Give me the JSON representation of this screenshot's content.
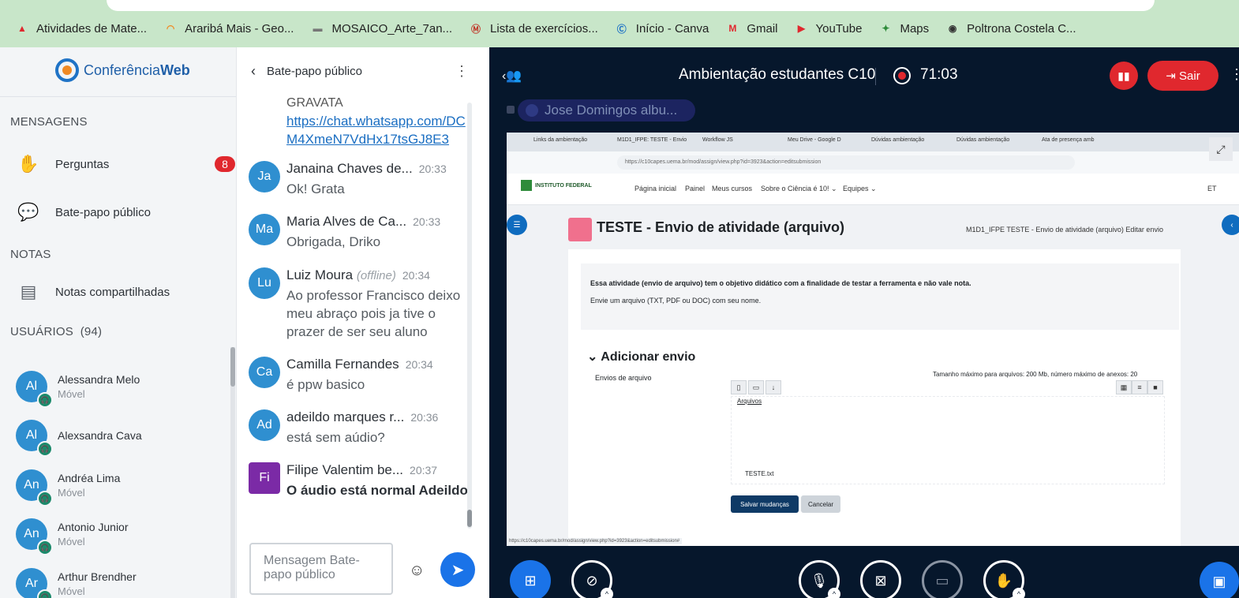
{
  "bookmarks": [
    {
      "label": "Atividades de Mate...",
      "icon": "red-triangle-icon",
      "color": "#e0282e"
    },
    {
      "label": "Araribá Mais - Geo...",
      "icon": "rainbow-icon",
      "color": "#f08a24"
    },
    {
      "label": "MOSAICO_Arte_7an...",
      "icon": "dash-icon",
      "color": "#777777"
    },
    {
      "label": "Lista de exercícios...",
      "icon": "circle-m-icon",
      "color": "#c0392b"
    },
    {
      "label": "Início - Canva",
      "icon": "canva-icon",
      "color": "#1f73c6"
    },
    {
      "label": "Gmail",
      "icon": "gmail-icon",
      "color": "#e0282e"
    },
    {
      "label": "YouTube",
      "icon": "youtube-icon",
      "color": "#e0282e"
    },
    {
      "label": "Maps",
      "icon": "maps-icon",
      "color": "#2e8b3a"
    },
    {
      "label": "Poltrona Costela C...",
      "icon": "globe-icon",
      "color": "#333333"
    }
  ],
  "logo": {
    "part1": "Conferência",
    "part2": "Web"
  },
  "sidebar": {
    "messages_header": "MENSAGENS",
    "questions_label": "Perguntas",
    "questions_badge": "8",
    "public_chat_label": "Bate-papo público",
    "notes_header": "NOTAS",
    "shared_notes_label": "Notas compartilhadas",
    "users_header": "USUÁRIOS",
    "users_count": "(94)",
    "users": [
      {
        "initials": "Al",
        "name": "Alessandra Melo",
        "status": "Móvel"
      },
      {
        "initials": "Al",
        "name": "Alexsandra Cava",
        "status": ""
      },
      {
        "initials": "An",
        "name": "Andréa Lima",
        "status": "Móvel"
      },
      {
        "initials": "An",
        "name": "Antonio Junior",
        "status": "Móvel"
      },
      {
        "initials": "Ar",
        "name": "Arthur Brendher",
        "status": "Móvel"
      }
    ]
  },
  "chat": {
    "title": "Bate-papo público",
    "cut_text": "GRAVATA",
    "link_text": "https://chat.whatsapp.com/DCM4XmeN7VdHx17tsGJ8E3",
    "messages": [
      {
        "initials": "Ja",
        "name": "Janaina Chaves de...",
        "offline": "",
        "time": "20:33",
        "text": "Ok! Grata"
      },
      {
        "initials": "Ma",
        "name": "Maria Alves de Ca...",
        "offline": "",
        "time": "20:33",
        "text": "Obrigada, Driko"
      },
      {
        "initials": "Lu",
        "name": "Luiz Moura",
        "offline": "(offline)",
        "time": "20:34",
        "text": "Ao professor Francisco deixo meu abraço pois ja tive o prazer de ser seu aluno"
      },
      {
        "initials": "Ca",
        "name": "Camilla Fernandes",
        "offline": "",
        "time": "20:34",
        "text": "é ppw basico"
      },
      {
        "initials": "Ad",
        "name": "adeildo marques r...",
        "offline": "",
        "time": "20:36",
        "text": "está sem aúdio?"
      },
      {
        "initials": "Fi",
        "name": "Filipe Valentim be...",
        "offline": "",
        "time": "20:37",
        "text": "O áudio está normal Adeildo."
      }
    ],
    "input_placeholder": "Mensagem Bate-papo público"
  },
  "meeting": {
    "title": "Ambientação estudantes C10",
    "timer": "71:03",
    "exit_label": "Sair",
    "talker": "Jose Domingos albu..."
  },
  "screen": {
    "tabs": [
      "Links da ambientação",
      "M1D1_IFPE: TESTE - Envio",
      "Workflow JS",
      "Meu Drive - Google D",
      "Dúvidas ambientação",
      "Dúvidas ambientação",
      "Ata de presença amb"
    ],
    "url": "https://c10capes.uema.br/mod/assign/view.php?id=3923&action=editsubmission",
    "institute": "INSTITUTO FEDERAL",
    "nav": [
      "Página inicial",
      "Painel",
      "Meus cursos",
      "Sobre o Ciência é 10! ⌄",
      "Equipes ⌄"
    ],
    "user_initials": "ET",
    "activity_title": "TESTE - Envio de atividade (arquivo)",
    "breadcrumbs": "M1D1_IFPE    TESTE - Envio de atividade (arquivo)    Editar envio",
    "intro_1": "Essa atividade (envio de arquivo) tem o objetivo didático com a finalidade de testar a ferramenta e não vale nota.",
    "intro_2": "Envie um arquivo (TXT, PDF ou DOC) com seu nome.",
    "add_heading": "Adicionar envio",
    "envios_label": "Envios de arquivo",
    "max_size": "Tamanho máximo para arquivos: 200 Mb, número máximo de anexos: 20",
    "files_link": "Arquivos",
    "file_name": "TESTE.txt",
    "save_label": "Salvar mudanças",
    "cancel_label": "Cancelar",
    "status_url": "https://c10capes.uema.br/mod/assign/view.php?id=3923&action=editsubmission#"
  }
}
